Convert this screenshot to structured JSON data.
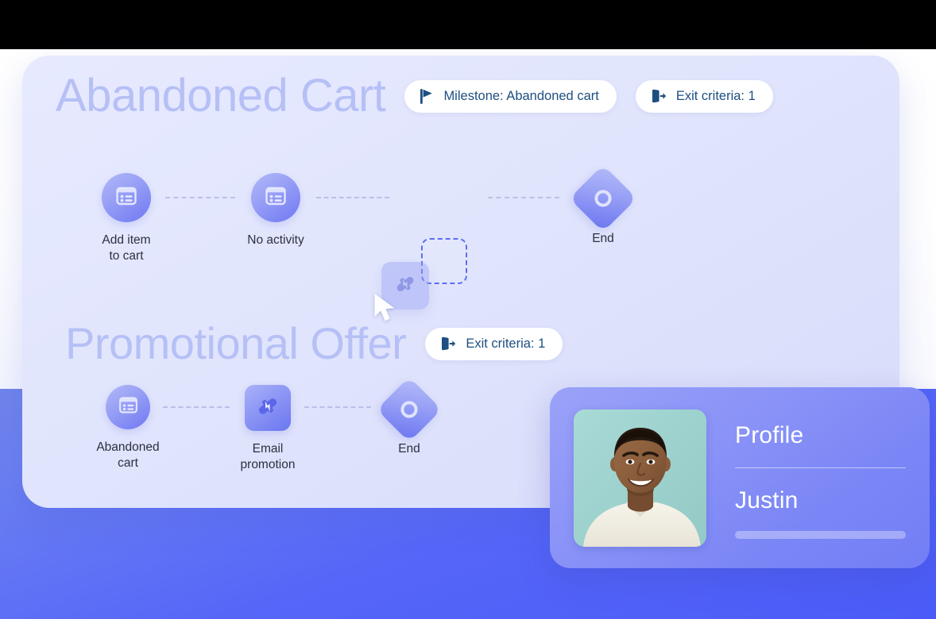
{
  "canvas": {
    "sections": [
      {
        "title": "Abandoned Cart",
        "pills": [
          {
            "icon": "flag-icon",
            "label": "Milestone: Abandoned cart"
          },
          {
            "icon": "exit-icon",
            "label": "Exit criteria: 1"
          }
        ],
        "nodes": [
          {
            "shape": "circle",
            "icon": "form-icon",
            "label": "Add item\nto cart"
          },
          {
            "shape": "circle",
            "icon": "form-icon",
            "label": "No activity"
          },
          {
            "shape": "diamond",
            "icon": "ring-icon",
            "label": "End"
          }
        ]
      },
      {
        "title": "Promotional Offer",
        "pills": [
          {
            "icon": "exit-icon",
            "label": "Exit criteria: 1"
          }
        ],
        "nodes": [
          {
            "shape": "circle",
            "icon": "form-icon",
            "label": "Abandoned\ncart"
          },
          {
            "shape": "square",
            "icon": "bolt-icon",
            "label": "Email\npromotion"
          },
          {
            "shape": "diamond",
            "icon": "ring-icon",
            "label": "End"
          }
        ]
      }
    ],
    "drag": {
      "tile_icon": "bolt-icon",
      "cursor_icon": "arrow-cursor-icon",
      "drop_target": "empty-step-slot"
    }
  },
  "profile": {
    "title": "Profile",
    "name": "Justin",
    "avatar_alt": "smiling-man-portrait"
  },
  "colors": {
    "canvas_bg": "#dde1fb",
    "page_bg": "#5566f8",
    "node_accent": "#6f78f2",
    "heading": "#b6c0f6",
    "pill_text": "#1d4f81",
    "profile_card": "#8b94f7"
  }
}
